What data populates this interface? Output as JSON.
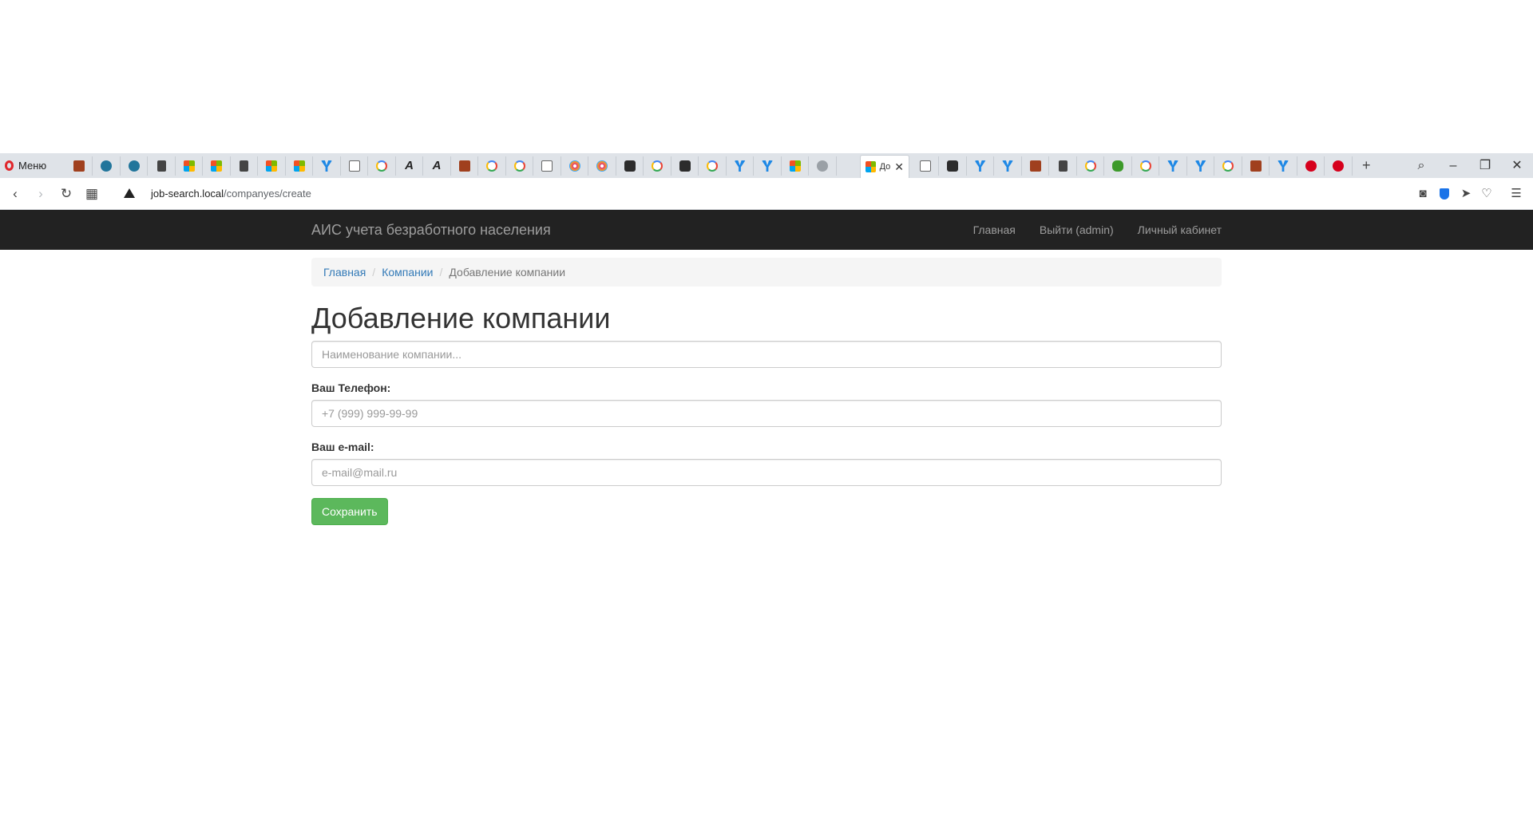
{
  "browser": {
    "menu_label": "Меню",
    "active_tab_label": "До",
    "url_host": "job-search.local",
    "url_path": "/companyes/create",
    "tab_favicons": [
      "pma-icon",
      "wordpress-icon",
      "wordpress-icon",
      "doc-icon",
      "microsoft-icon",
      "microsoft-icon",
      "doc-icon",
      "microsoft-icon",
      "microsoft-icon",
      "yandex-icon",
      "app-icon",
      "google-icon",
      "a-icon",
      "a-icon",
      "brown-icon",
      "google-icon",
      "google-icon",
      "code-icon",
      "flower-icon",
      "flower-icon",
      "dark-icon",
      "google-icon",
      "dark-icon",
      "google-icon",
      "yandex-icon",
      "yandex-icon",
      "microsoft-icon",
      "grey-icon"
    ],
    "tab_favicons_after": [
      "mail-icon",
      "dark-icon",
      "blue-icon",
      "yandex-icon",
      "brown-icon",
      "grid-icon",
      "google-icon",
      "puzzle-icon",
      "google-icon",
      "yandex-icon",
      "yandex-icon",
      "google-icon",
      "brown-icon",
      "yandex-icon",
      "hh-icon",
      "hh-icon"
    ]
  },
  "site": {
    "brand": "АИС учета безработного населения",
    "nav": {
      "home": "Главная",
      "logout": "Выйти (admin)",
      "cabinet": "Личный кабинет"
    }
  },
  "breadcrumb": {
    "home": "Главная",
    "companies": "Компании",
    "current": "Добавление компании",
    "separator": "/"
  },
  "page": {
    "title": "Добавление компании"
  },
  "form": {
    "name_placeholder": "Наименование компании...",
    "phone_label": "Ваш Телефон:",
    "phone_placeholder": "+7 (999) 999-99-99",
    "email_label": "Ваш e-mail:",
    "email_placeholder": "e-mail@mail.ru",
    "save_label": "Сохранить"
  },
  "colors": {
    "navbar_bg": "#222222",
    "link": "#337ab7",
    "success": "#5cb85c"
  }
}
